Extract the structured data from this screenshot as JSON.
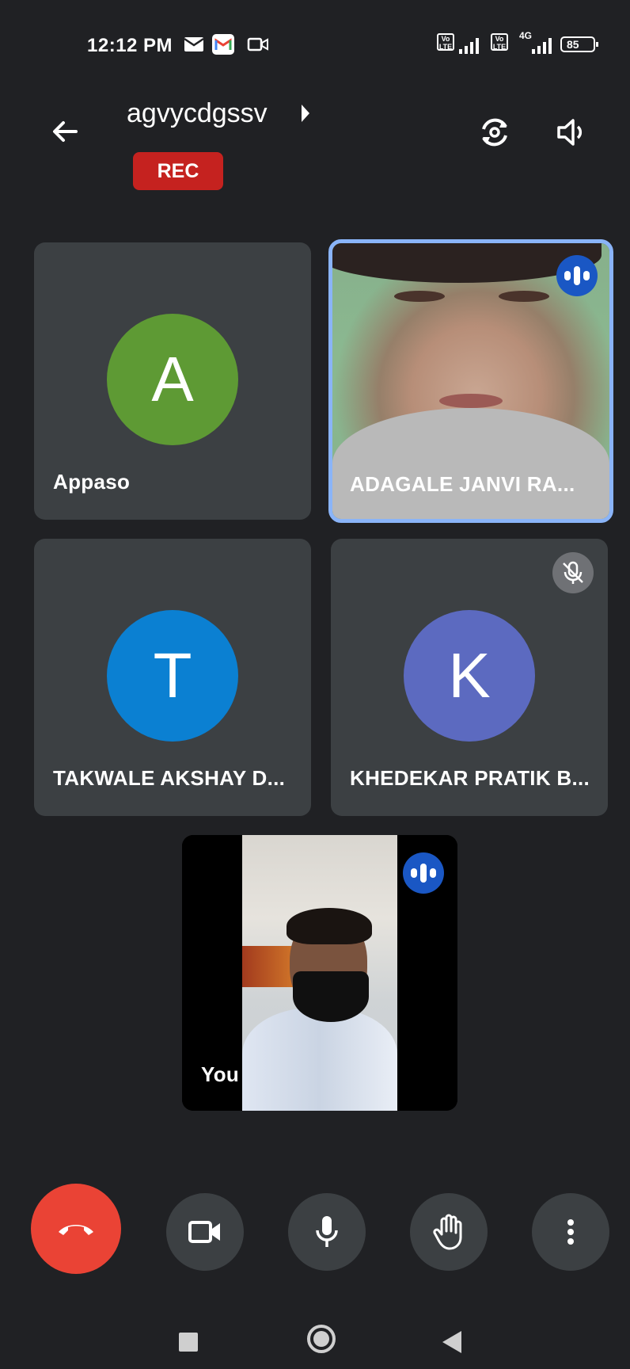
{
  "status_bar": {
    "time": "12:12 PM",
    "icons": [
      "gmail-outline-icon",
      "gmail-icon",
      "video-icon"
    ],
    "signal1_label": "Vo LTE",
    "signal2_label": "Vo LTE",
    "network_label": "4G",
    "battery": "85"
  },
  "header": {
    "meeting_title": "agvycdgssv",
    "rec_badge": "REC"
  },
  "participants": [
    {
      "name": "Appaso",
      "initial": "A",
      "avatar_color": "#5e9a34"
    },
    {
      "name": "ADAGALE  JANVI  RA...",
      "speaking": true
    },
    {
      "name": "TAKWALE AKSHAY D...",
      "initial": "T",
      "avatar_color": "#0b80d2"
    },
    {
      "name": "KHEDEKAR PRATIK B...",
      "initial": "K",
      "avatar_color": "#5c6ac0",
      "muted": true
    }
  ],
  "self_view": {
    "name": "You",
    "speaking": true
  },
  "controls": {
    "items": [
      "hang-up-icon",
      "camera-icon",
      "microphone-icon",
      "raise-hand-icon",
      "more-options-icon"
    ]
  },
  "colors": {
    "background": "#202124",
    "tile": "#3c4043",
    "active_border": "#8ab4f8",
    "hangup": "#ea4335",
    "rec": "#c5221f"
  }
}
